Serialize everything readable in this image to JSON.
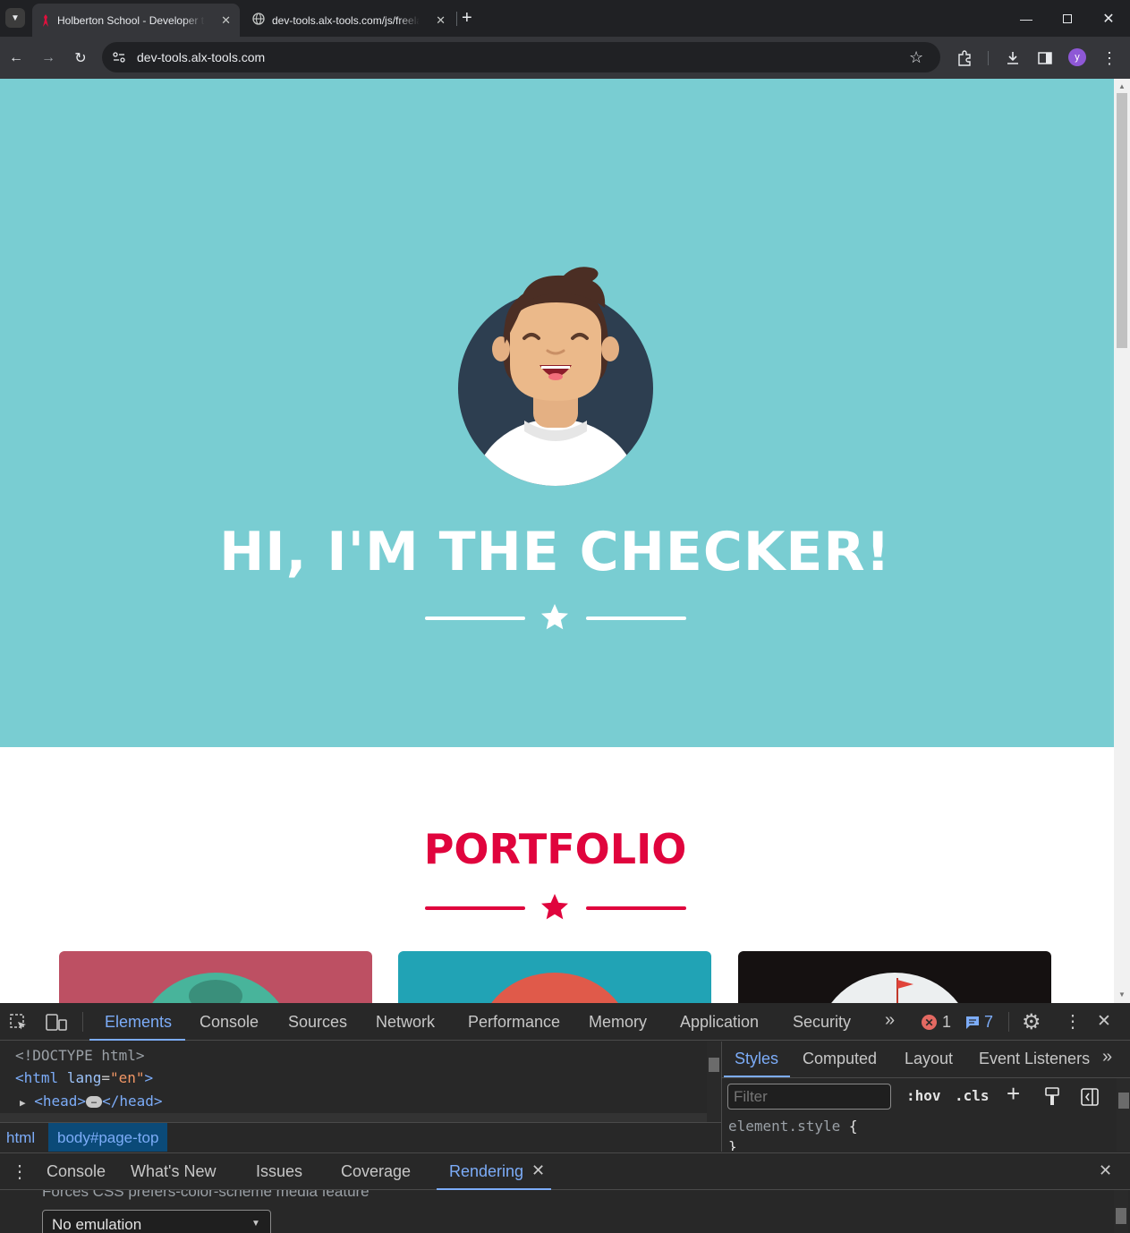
{
  "browser": {
    "tabs": [
      {
        "title": "Holberton School - Developer tools",
        "active": true
      },
      {
        "title": "dev-tools.alx-tools.com/js/freelancer.min.js",
        "active": false
      }
    ],
    "url": "dev-tools.alx-tools.com",
    "profile_initial": "y",
    "profile_color": "#8e58d6"
  },
  "page": {
    "hero_bg": "#79cdd2",
    "hero_title": "HI, I'M THE CHECKER!",
    "portfolio_title": "PORTFOLIO",
    "accent": "#e0043d",
    "card_colors": [
      "#bd5063",
      "#21a3b5",
      "#151111"
    ]
  },
  "devtools": {
    "tabs": [
      "Elements",
      "Console",
      "Sources",
      "Network",
      "Performance",
      "Memory",
      "Application",
      "Security"
    ],
    "error_count": "1",
    "message_count": "7",
    "elements_lines": [
      {
        "text": "<!DOCTYPE html>"
      },
      {
        "tag_open": "<html",
        "attr_name": "lang",
        "attr_value": "\"en\"",
        "tag_close": ">"
      },
      {
        "head": "<head>",
        "head_close": "</head>",
        "ellipsis": "…"
      }
    ],
    "breadcrumb": [
      "html",
      "body#page-top"
    ],
    "styles_tabs": [
      "Styles",
      "Computed",
      "Layout",
      "Event Listeners"
    ],
    "filter_placeholder": "Filter",
    "hov_label": ":hov",
    "cls_label": ".cls",
    "element_style": "element.style",
    "drawer_tabs": [
      "Console",
      "What's New",
      "Issues",
      "Coverage",
      "Rendering"
    ],
    "rendering_label": "Forces CSS prefers-color-scheme media feature",
    "emulation_select": "No emulation"
  }
}
